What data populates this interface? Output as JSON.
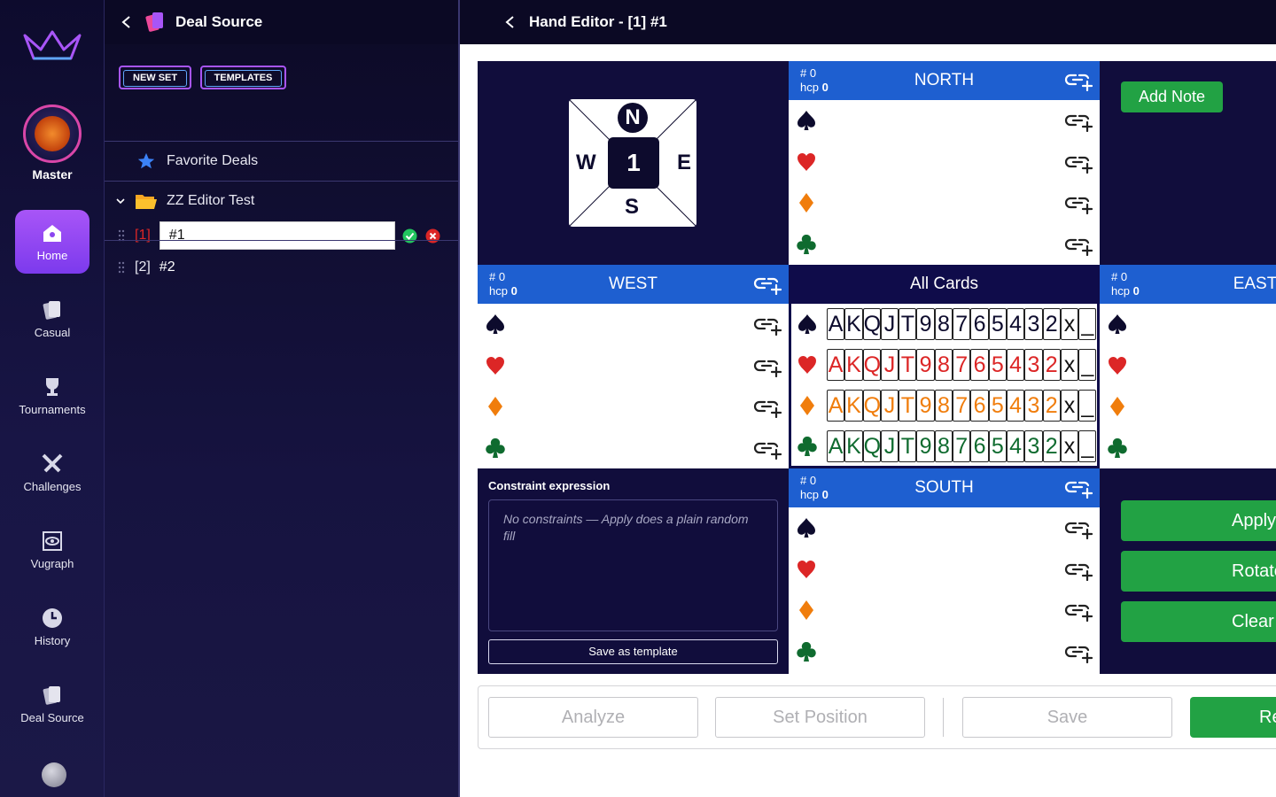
{
  "nav": {
    "rank_label": "Master",
    "items": [
      {
        "label": "Home",
        "icon": "home-icon",
        "active": true
      },
      {
        "label": "Casual",
        "icon": "cards-icon"
      },
      {
        "label": "Tournaments",
        "icon": "trophy-icon"
      },
      {
        "label": "Challenges",
        "icon": "swords-icon"
      },
      {
        "label": "Vugraph",
        "icon": "eye-icon"
      },
      {
        "label": "History",
        "icon": "clock-icon"
      },
      {
        "label": "Deal Source",
        "icon": "deal-source-icon"
      }
    ]
  },
  "panel": {
    "title": "Deal Source",
    "new_set": "NEW SET",
    "templates": "TEMPLATES",
    "favorites": "Favorite Deals",
    "folder": "ZZ Editor Test",
    "items": [
      {
        "index": "[1]",
        "name": "#1"
      },
      {
        "index": "[2]",
        "name": "#2"
      }
    ]
  },
  "editor": {
    "title": "Hand Editor - [1] #1",
    "compass": {
      "n": "N",
      "w": "W",
      "e": "E",
      "s": "S",
      "board": "1"
    },
    "add_note": "Add Note",
    "all_cards": "All Cards",
    "hands": {
      "north": {
        "name": "NORTH",
        "count": "# 0",
        "hcp_label": "hcp",
        "hcp": "0"
      },
      "west": {
        "name": "WEST",
        "count": "# 0",
        "hcp_label": "hcp",
        "hcp": "0"
      },
      "east": {
        "name": "EAST",
        "count": "# 0",
        "hcp_label": "hcp",
        "hcp": "0"
      },
      "south": {
        "name": "SOUTH",
        "count": "# 0",
        "hcp_label": "hcp",
        "hcp": "0"
      }
    },
    "card_ranks": [
      "A",
      "K",
      "Q",
      "J",
      "T",
      "9",
      "8",
      "7",
      "6",
      "5",
      "4",
      "3",
      "2",
      "x",
      "_"
    ],
    "suit_colors": {
      "spades": "#0d0b2d",
      "hearts": "#dc2626",
      "diamonds": "#f07d0c",
      "clubs": "#0f6b2f"
    },
    "constraint_label": "Constraint expression",
    "constraint_placeholder": "No constraints — Apply does a plain random fill",
    "save_template": "Save as template",
    "side_buttons": [
      "Apply",
      "Rotate",
      "Clear"
    ],
    "bottom_buttons": {
      "analyze": "Analyze",
      "set_position": "Set Position",
      "save": "Save",
      "green": "Re"
    }
  }
}
